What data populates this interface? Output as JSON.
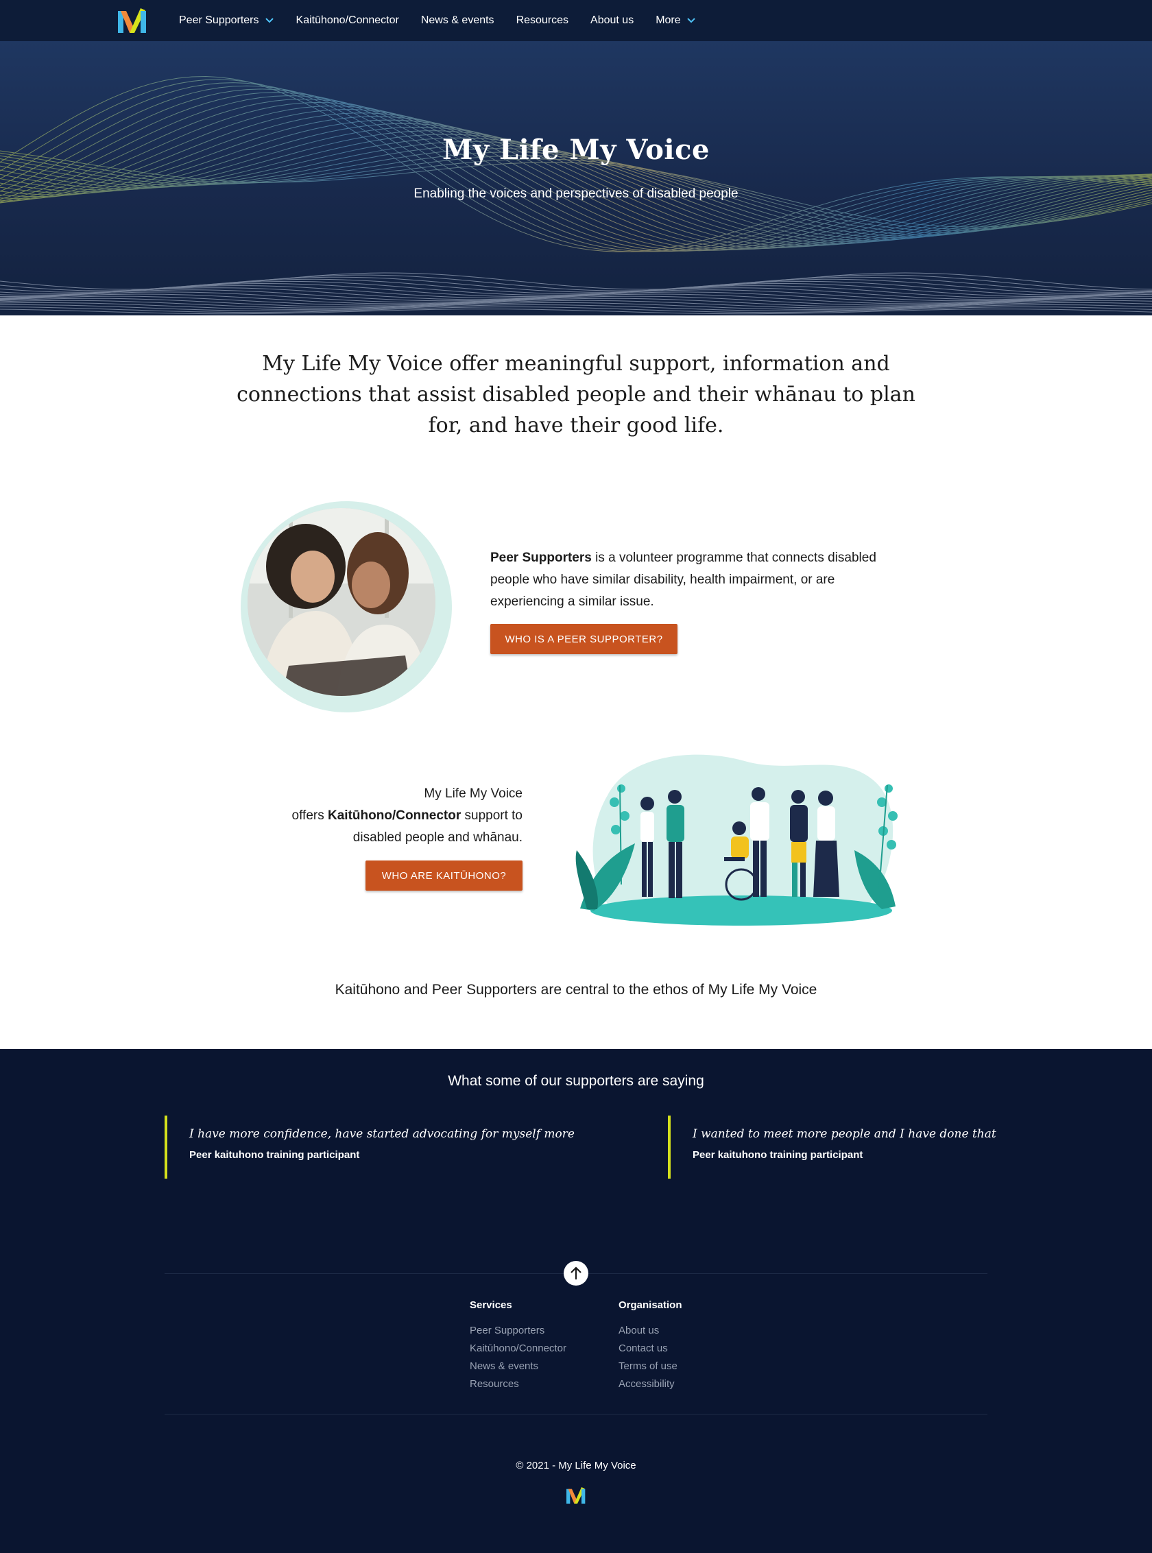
{
  "nav": {
    "items": [
      {
        "label": "Peer Supporters",
        "dropdown": true
      },
      {
        "label": "Kaitūhono/Connector",
        "dropdown": false
      },
      {
        "label": "News & events",
        "dropdown": false
      },
      {
        "label": "Resources",
        "dropdown": false
      },
      {
        "label": "About us",
        "dropdown": false
      },
      {
        "label": "More",
        "dropdown": true
      }
    ]
  },
  "hero": {
    "title": "My Life My Voice",
    "subtitle": "Enabling the voices and perspectives of disabled people"
  },
  "intro": "My Life My Voice offer meaningful support, information and connections that assist disabled people and their whānau to plan for, and have their good life.",
  "peer": {
    "bold": "Peer Supporters",
    "text": " is a volunteer programme that connects disabled people who have similar disability, health impairment, or are experiencing a similar issue.",
    "button": "WHO IS A PEER SUPPORTER?"
  },
  "kaituhono": {
    "line1": "My Life My Voice",
    "pre": "offers ",
    "bold": "Kaitūhono/Connector",
    "post": " support to disabled people and whānau.",
    "button": "WHO ARE KAITŪHONO?"
  },
  "ethos": "Kaitūhono and Peer Supporters are central to the ethos of My Life My Voice",
  "testimonials": {
    "heading": "What some of our supporters are saying",
    "items": [
      {
        "quote": "I have more confidence, have started advocating for myself more",
        "author": "Peer kaituhono training participant"
      },
      {
        "quote": "I wanted to meet more people and I have done that",
        "author": "Peer kaituhono training participant"
      }
    ]
  },
  "footer": {
    "services": {
      "heading": "Services",
      "links": [
        "Peer Supporters",
        "Kaitūhono/Connector",
        "News & events",
        "Resources"
      ]
    },
    "organisation": {
      "heading": "Organisation",
      "links": [
        "About us",
        "Contact us",
        "Terms of use",
        "Accessibility"
      ]
    },
    "copyright": "© 2021 - My Life My Voice"
  },
  "colors": {
    "nav_bg": "#0d1c38",
    "accent_button": "#c8531f",
    "quote_bar": "#d4e01c",
    "footer_bg": "#0a1530",
    "ring": "#d6efea"
  },
  "icons": [
    "logo-icon",
    "chevron-down-icon",
    "arrow-up-icon",
    "photo-peer-supporters",
    "illustration-group"
  ]
}
